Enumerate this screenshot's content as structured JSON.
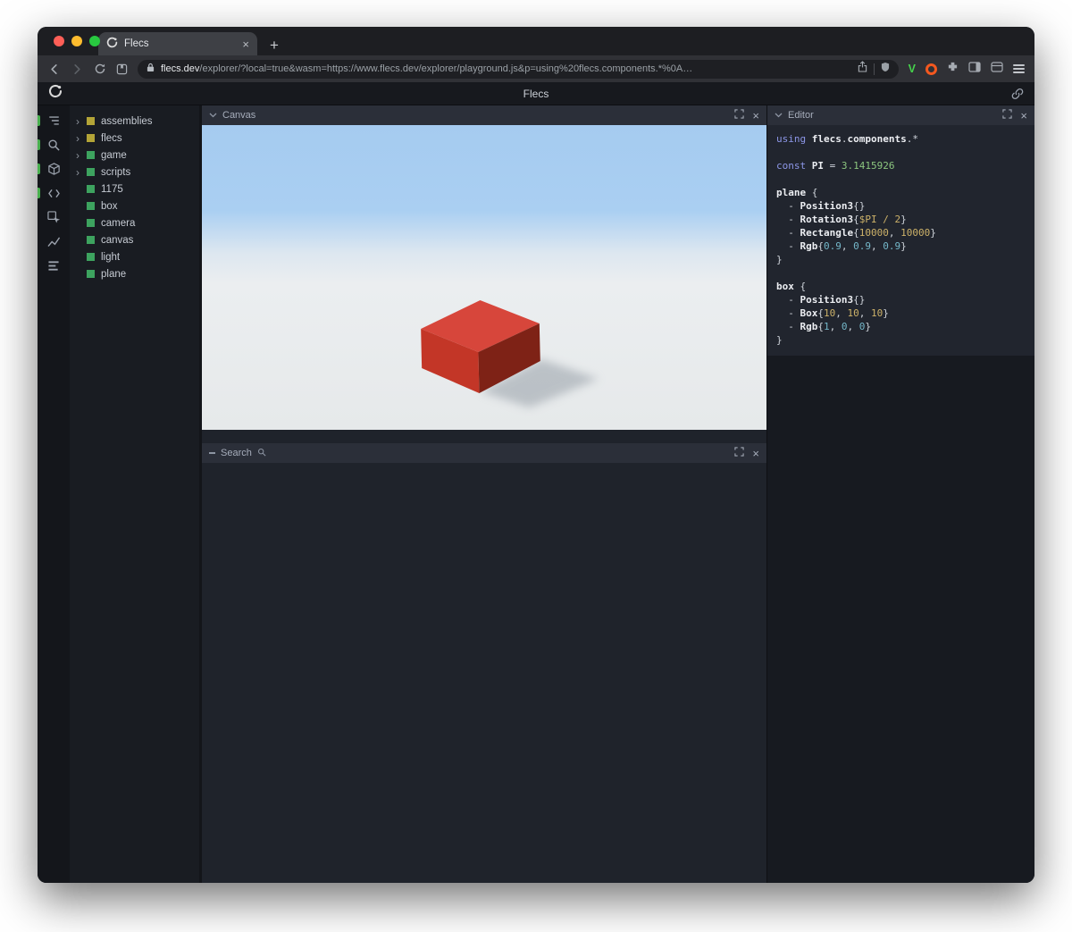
{
  "browser": {
    "tab": {
      "title": "Flecs"
    },
    "toolbar": {
      "url_host": "flecs.dev",
      "url_rest": "/explorer/?local=true&wasm=https://www.flecs.dev/explorer/playground.js&p=using%20flecs.components.*%0A…",
      "extension_v_badge": "V"
    }
  },
  "app": {
    "title": "Flecs",
    "rail_icons": [
      "entity-tree-icon",
      "search-icon",
      "cube-icon",
      "code-icon",
      "inspect-icon",
      "chart-icon",
      "stats-icon"
    ],
    "tree": {
      "items": [
        {
          "label": "assemblies",
          "color": "yellow",
          "expandable": true
        },
        {
          "label": "flecs",
          "color": "yellow",
          "expandable": true
        },
        {
          "label": "game",
          "color": "green",
          "expandable": true
        },
        {
          "label": "scripts",
          "color": "green",
          "expandable": true
        },
        {
          "label": "1175",
          "color": "green",
          "expandable": false
        },
        {
          "label": "box",
          "color": "green",
          "expandable": false
        },
        {
          "label": "camera",
          "color": "green",
          "expandable": false
        },
        {
          "label": "canvas",
          "color": "green",
          "expandable": false
        },
        {
          "label": "light",
          "color": "green",
          "expandable": false
        },
        {
          "label": "plane",
          "color": "green",
          "expandable": false
        }
      ]
    },
    "panels": {
      "canvas": {
        "title": "Canvas"
      },
      "search": {
        "title": "Search"
      },
      "editor": {
        "title": "Editor"
      }
    },
    "editor_code": {
      "lines": [
        [
          {
            "t": "using",
            "c": "kw"
          },
          {
            "t": " ",
            "c": "pl"
          },
          {
            "t": "flecs",
            "c": "id"
          },
          {
            "t": ".",
            "c": "pl"
          },
          {
            "t": "components",
            "c": "id"
          },
          {
            "t": ".*",
            "c": "pl"
          }
        ],
        [],
        [
          {
            "t": "const",
            "c": "kw"
          },
          {
            "t": " ",
            "c": "pl"
          },
          {
            "t": "PI",
            "c": "id"
          },
          {
            "t": " = ",
            "c": "pl"
          },
          {
            "t": "3.1415926",
            "c": "ng"
          }
        ],
        [],
        [
          {
            "t": "plane",
            "c": "id"
          },
          {
            "t": " {",
            "c": "pl"
          }
        ],
        [
          {
            "t": "  - ",
            "c": "pl"
          },
          {
            "t": "Position3",
            "c": "id"
          },
          {
            "t": "{}",
            "c": "pl"
          }
        ],
        [
          {
            "t": "  - ",
            "c": "pl"
          },
          {
            "t": "Rotation3",
            "c": "id"
          },
          {
            "t": "{",
            "c": "pl"
          },
          {
            "t": "$PI / 2",
            "c": "ny"
          },
          {
            "t": "}",
            "c": "pl"
          }
        ],
        [
          {
            "t": "  - ",
            "c": "pl"
          },
          {
            "t": "Rectangle",
            "c": "id"
          },
          {
            "t": "{",
            "c": "pl"
          },
          {
            "t": "10000",
            "c": "ny"
          },
          {
            "t": ", ",
            "c": "pl"
          },
          {
            "t": "10000",
            "c": "ny"
          },
          {
            "t": "}",
            "c": "pl"
          }
        ],
        [
          {
            "t": "  - ",
            "c": "pl"
          },
          {
            "t": "Rgb",
            "c": "id"
          },
          {
            "t": "{",
            "c": "pl"
          },
          {
            "t": "0.9",
            "c": "nt"
          },
          {
            "t": ", ",
            "c": "pl"
          },
          {
            "t": "0.9",
            "c": "nt"
          },
          {
            "t": ", ",
            "c": "pl"
          },
          {
            "t": "0.9",
            "c": "nt"
          },
          {
            "t": "}",
            "c": "pl"
          }
        ],
        [
          {
            "t": "}",
            "c": "pl"
          }
        ],
        [],
        [
          {
            "t": "box",
            "c": "id"
          },
          {
            "t": " {",
            "c": "pl"
          }
        ],
        [
          {
            "t": "  - ",
            "c": "pl"
          },
          {
            "t": "Position3",
            "c": "id"
          },
          {
            "t": "{}",
            "c": "pl"
          }
        ],
        [
          {
            "t": "  - ",
            "c": "pl"
          },
          {
            "t": "Box",
            "c": "id"
          },
          {
            "t": "{",
            "c": "pl"
          },
          {
            "t": "10",
            "c": "ny"
          },
          {
            "t": ", ",
            "c": "pl"
          },
          {
            "t": "10",
            "c": "ny"
          },
          {
            "t": ", ",
            "c": "pl"
          },
          {
            "t": "10",
            "c": "ny"
          },
          {
            "t": "}",
            "c": "pl"
          }
        ],
        [
          {
            "t": "  - ",
            "c": "pl"
          },
          {
            "t": "Rgb",
            "c": "id"
          },
          {
            "t": "{",
            "c": "pl"
          },
          {
            "t": "1",
            "c": "nt"
          },
          {
            "t": ", ",
            "c": "pl"
          },
          {
            "t": "0",
            "c": "nt"
          },
          {
            "t": ", ",
            "c": "pl"
          },
          {
            "t": "0",
            "c": "nt"
          },
          {
            "t": "}",
            "c": "pl"
          }
        ],
        [
          {
            "t": "}",
            "c": "pl"
          }
        ]
      ]
    },
    "colors": {
      "accent_green": "#49b04f",
      "square_yellow": "#b3a437",
      "square_green": "#3da35f",
      "sky_top": "#a5cbf0",
      "ground": "#e6e9ea",
      "box_red_top": "#d7463b",
      "box_red_front": "#c33627",
      "box_red_side": "#7e2216"
    }
  }
}
